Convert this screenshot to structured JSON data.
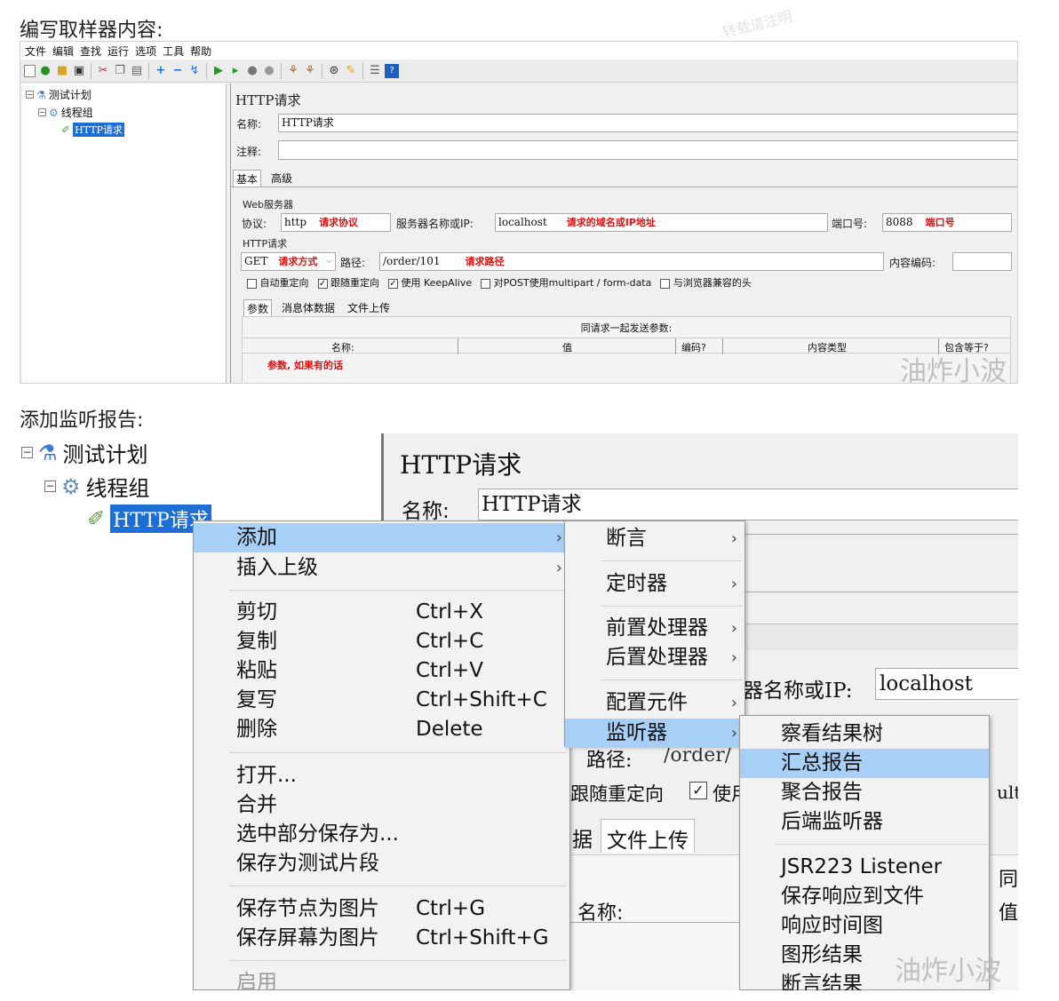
{
  "heading1": "编写取样器内容:",
  "heading2": "添加监听报告:",
  "watermark": "油炸小波",
  "watermark_faint": "转载请注明",
  "shot1": {
    "menubar": [
      "文件",
      "编辑",
      "查找",
      "运行",
      "选项",
      "工具",
      "帮助"
    ],
    "tree": {
      "plan": "测试计划",
      "group": "线程组",
      "sampler": "HTTP请求"
    },
    "panel_title": "HTTP请求",
    "name_label": "名称:",
    "name_value": "HTTP请求",
    "comment_label": "注释:",
    "tabs": [
      "基本",
      "高级"
    ],
    "web_server_label": "Web服务器",
    "protocol_label": "协议:",
    "protocol_value": "http",
    "protocol_note": "请求协议",
    "server_label": "服务器名称或IP:",
    "server_value": "localhost",
    "server_note": "请求的域名或IP地址",
    "port_label": "端口号:",
    "port_value": "8088",
    "port_note": "端口号",
    "http_request_label": "HTTP请求",
    "method_value": "GET",
    "method_note": "请求方式",
    "path_label": "路径:",
    "path_value": "/order/101",
    "path_note": "请求路径",
    "encoding_label": "内容编码:",
    "checkboxes": [
      {
        "label": "自动重定向",
        "checked": false
      },
      {
        "label": "跟随重定向",
        "checked": true
      },
      {
        "label": "使用 KeepAlive",
        "checked": true
      },
      {
        "label": "对POST使用multipart / form-data",
        "checked": false
      },
      {
        "label": "与浏览器兼容的头",
        "checked": false
      }
    ],
    "subtabs": [
      "参数",
      "消息体数据",
      "文件上传"
    ],
    "params_header": "同请求一起发送参数:",
    "columns": [
      "名称:",
      "值",
      "编码?",
      "内容类型",
      "包含等于?"
    ],
    "params_note": "参数, 如果有的话"
  },
  "shot2": {
    "tree": {
      "plan": "测试计划",
      "group": "线程组",
      "sampler": "HTTP请求"
    },
    "panel_title": "HTTP请求",
    "name_label": "名称:",
    "name_value": "HTTP请求",
    "server_label_partial": "器名称或IP:",
    "server_value": "localhost",
    "path_label_partial": "路径:",
    "path_value_partial": "/order/",
    "follow_redirect": "跟随重定向",
    "use_partial": "使用",
    "tab_partial": "据",
    "tab_upload": "文件上传",
    "name_col": "名称:",
    "right_partial_1": "同",
    "right_partial_2": "值",
    "right_partial_3": "ult",
    "context_menu": [
      {
        "label": "添加",
        "arrow": true,
        "highlight": true
      },
      {
        "label": "插入上级",
        "arrow": true
      },
      {
        "label": "剪切",
        "shortcut": "Ctrl+X"
      },
      {
        "label": "复制",
        "shortcut": "Ctrl+C"
      },
      {
        "label": "粘贴",
        "shortcut": "Ctrl+V"
      },
      {
        "label": "复写",
        "shortcut": "Ctrl+Shift+C"
      },
      {
        "label": "删除",
        "shortcut": "Delete"
      },
      {
        "label": "打开..."
      },
      {
        "label": "合并"
      },
      {
        "label": "选中部分保存为..."
      },
      {
        "label": "保存为测试片段"
      },
      {
        "label": "保存节点为图片",
        "shortcut": "Ctrl+G"
      },
      {
        "label": "保存屏幕为图片",
        "shortcut": "Ctrl+Shift+G"
      },
      {
        "label": "启用"
      }
    ],
    "add_submenu": [
      {
        "label": "断言"
      },
      {
        "label": "定时器"
      },
      {
        "label": "前置处理器"
      },
      {
        "label": "后置处理器"
      },
      {
        "label": "配置元件"
      },
      {
        "label": "监听器",
        "highlight": true
      }
    ],
    "listener_submenu": [
      {
        "label": "察看结果树"
      },
      {
        "label": "汇总报告",
        "highlight": true
      },
      {
        "label": "聚合报告"
      },
      {
        "label": "后端监听器"
      },
      {
        "label": "JSR223 Listener"
      },
      {
        "label": "保存响应到文件"
      },
      {
        "label": "响应时间图"
      },
      {
        "label": "图形结果"
      },
      {
        "label": "断言结果"
      }
    ]
  }
}
